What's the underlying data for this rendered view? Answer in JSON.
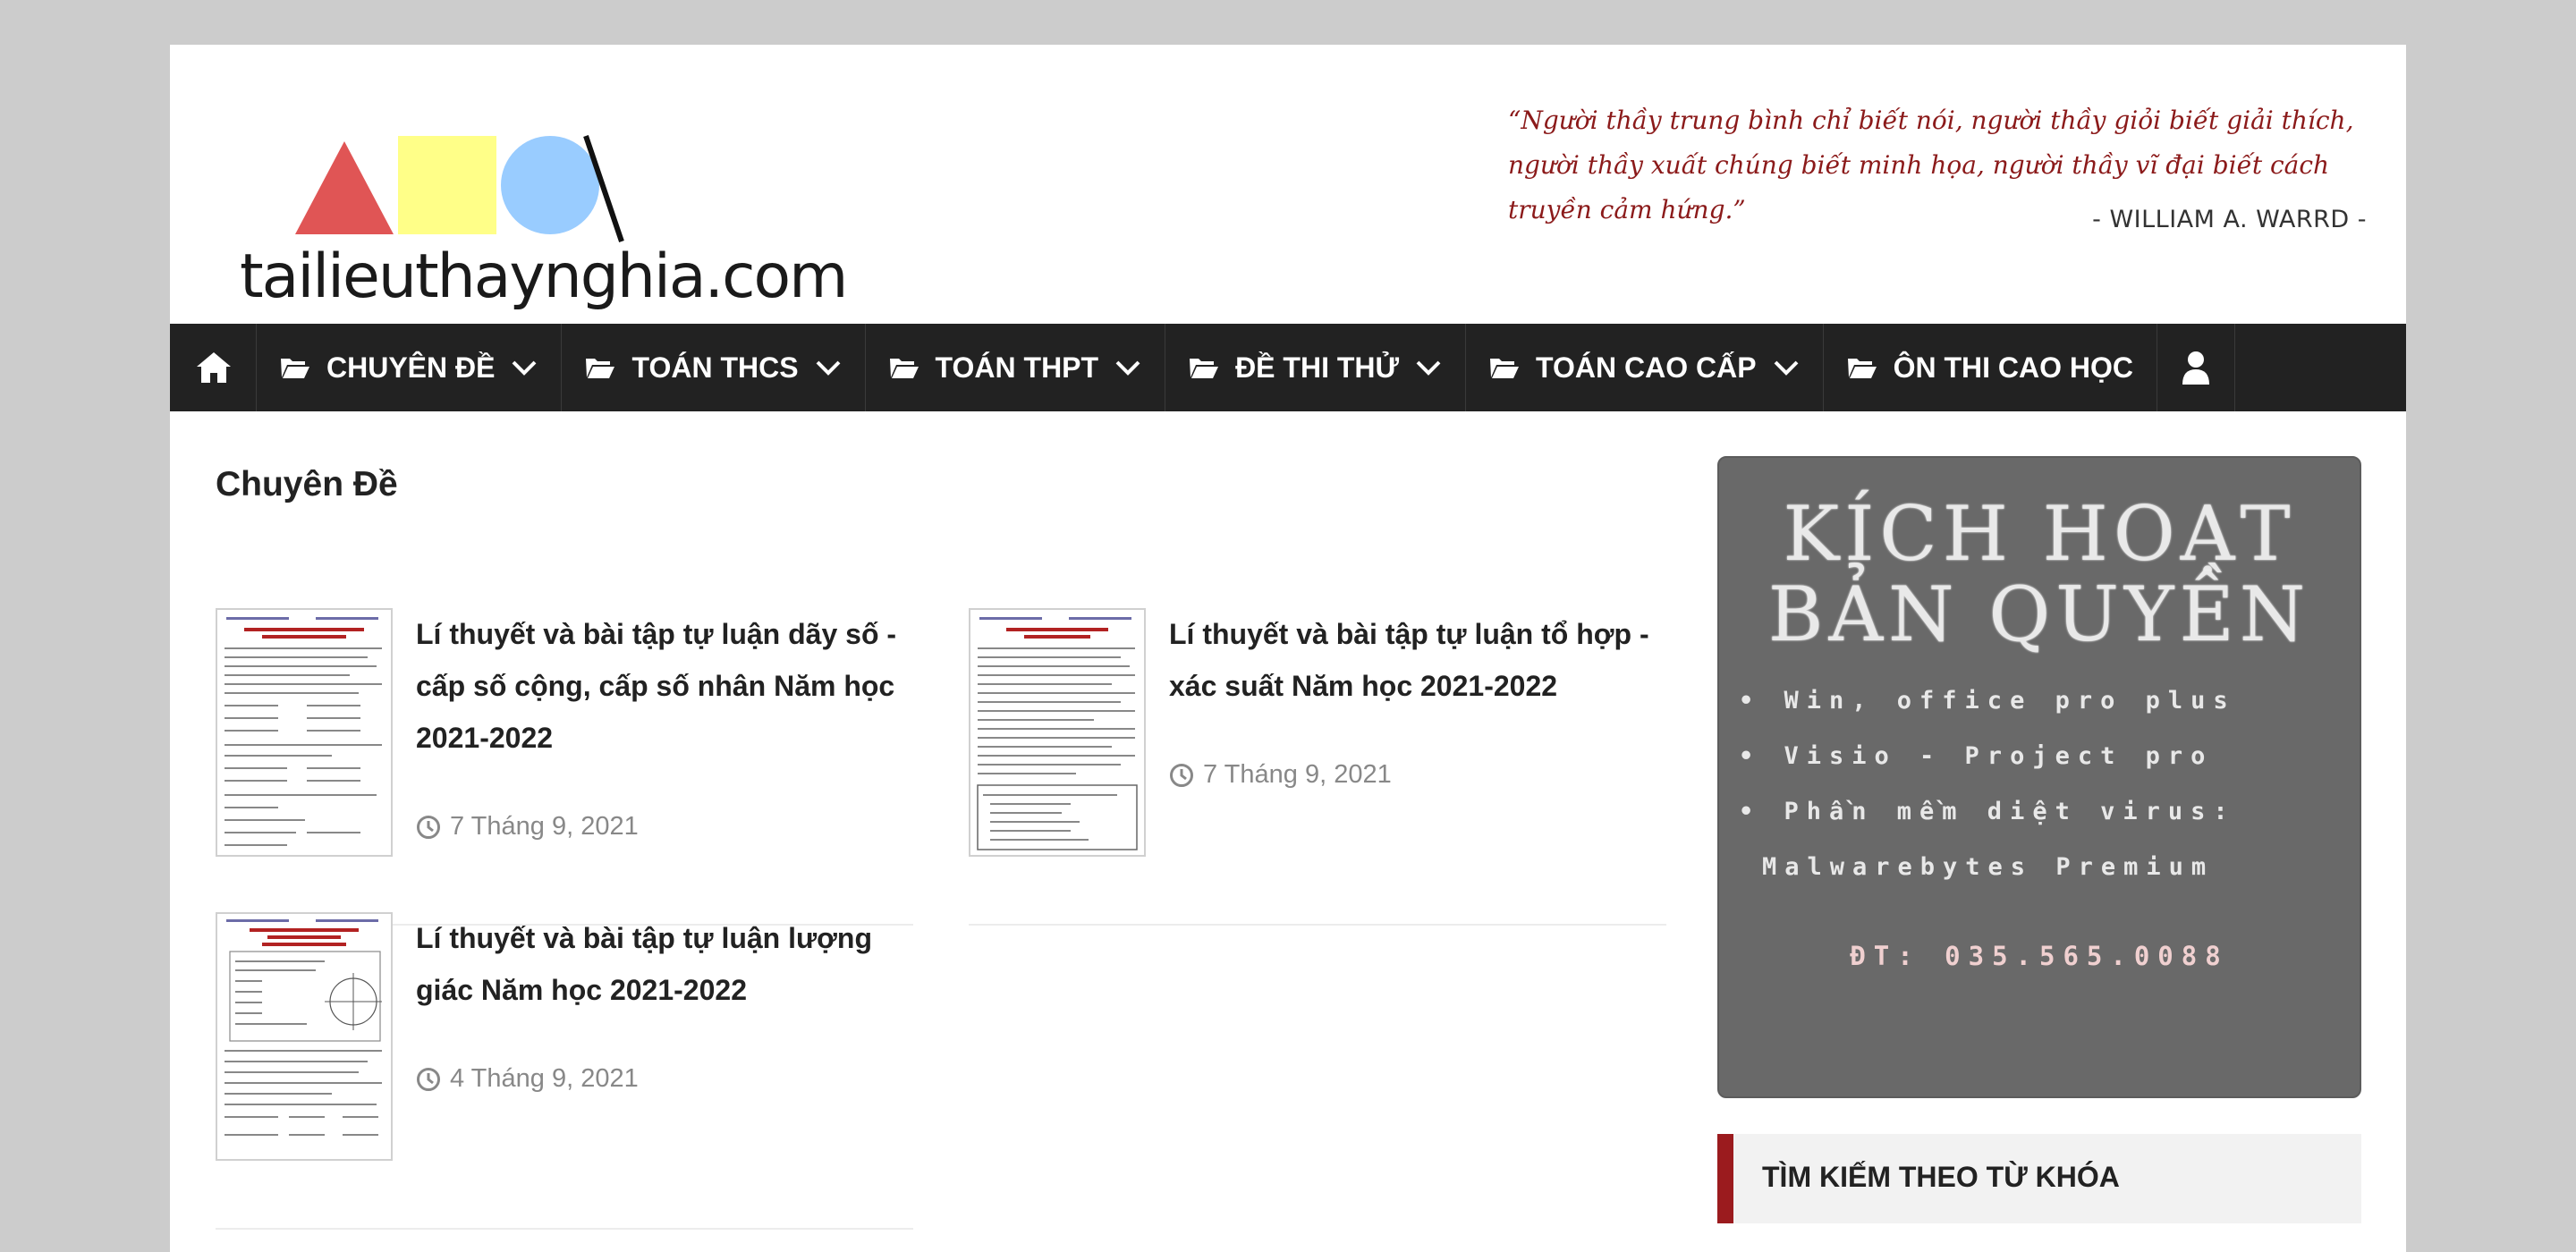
{
  "site": {
    "logo_text": "tailieuthaynghia.com",
    "quote": "“Người thầy trung bình chỉ biết nói, người thầy giỏi biết giải thích, người thầy xuất chúng biết minh họa, người thầy vĩ đại biết cách truyền cảm hứng.”",
    "quote_author": "- WILLIAM A. WARRD -"
  },
  "nav": {
    "items": [
      {
        "label": "CHUYÊN ĐỀ"
      },
      {
        "label": "TOÁN THCS"
      },
      {
        "label": "TOÁN THPT"
      },
      {
        "label": "ĐỀ THI THỬ"
      },
      {
        "label": "TOÁN CAO CẤP"
      },
      {
        "label": "ÔN THI CAO HỌC"
      }
    ]
  },
  "main": {
    "category_title": "Chuyên Đề",
    "posts": [
      {
        "title": "Lí thuyết và bài tập tự luận dãy số - cấp số cộng, cấp số nhân Năm học 2021-2022",
        "date": "7 Tháng 9, 2021"
      },
      {
        "title": "Lí thuyết và bài tập tự luận tổ hợp - xác suất Năm học 2021-2022",
        "date": "7 Tháng 9, 2021"
      },
      {
        "title": "Lí thuyết và bài tập tự luận lượng giác Năm học 2021-2022",
        "date": "4 Tháng 9, 2021"
      }
    ]
  },
  "sidebar": {
    "ad": {
      "title_line1": "KÍCH HOẠT",
      "title_line2": "BẢN QUYỀN",
      "bullets": [
        "• Win, office pro plus",
        "• Visio - Project pro",
        "• Phần mềm diệt virus:",
        "Malwarebytes Premium"
      ],
      "phone": "ĐT: 035.565.0088"
    },
    "widget_title": "TÌM KIẾM THEO TỪ KHÓA"
  },
  "colors": {
    "nav_bg": "#222222",
    "accent": "#9b1b1e",
    "quote": "#8b1a1a"
  }
}
